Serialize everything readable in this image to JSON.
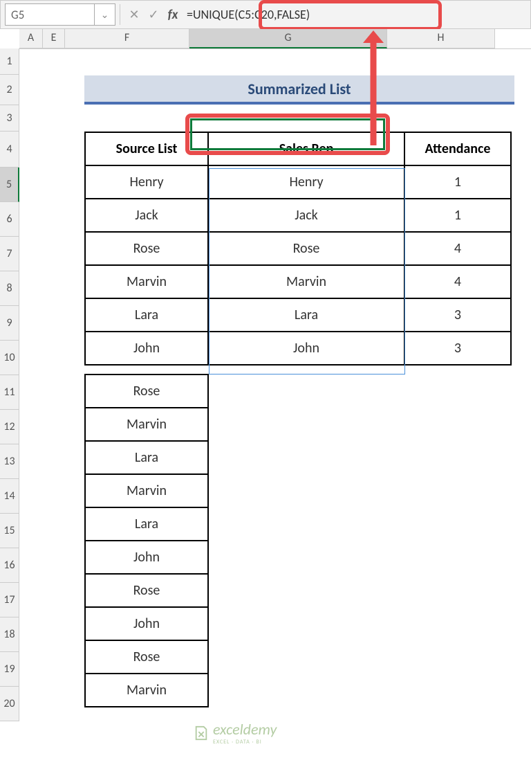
{
  "name_box": "G5",
  "formula": "=UNIQUE(C5:C20,FALSE)",
  "columns": [
    "A",
    "E",
    "F",
    "G",
    "H"
  ],
  "row_numbers": [
    1,
    2,
    3,
    4,
    5,
    6,
    7,
    8,
    9,
    10,
    11,
    12,
    13,
    14,
    15,
    16,
    17,
    18,
    19,
    20
  ],
  "banner_title": "Summarized List",
  "headers": {
    "f": "Source List",
    "g": "Sales Rep",
    "h": "Attendance"
  },
  "source_list": [
    "Henry",
    "Jack",
    "Rose",
    "Marvin",
    "Lara",
    "John",
    "Rose",
    "Marvin",
    "Lara",
    "Marvin",
    "Lara",
    "John",
    "Rose",
    "John",
    "Rose",
    "Marvin"
  ],
  "sales_rep": [
    "Henry",
    "Jack",
    "Rose",
    "Marvin",
    "Lara",
    "John"
  ],
  "attendance": [
    1,
    1,
    4,
    4,
    3,
    3
  ],
  "watermark": {
    "brand": "exceldemy",
    "tagline": "EXCEL · DATA · BI"
  },
  "chart_data": {
    "type": "table",
    "title": "Summarized List",
    "columns": [
      "Source List",
      "Sales Rep",
      "Attendance"
    ],
    "rows": [
      [
        "Henry",
        "Henry",
        1
      ],
      [
        "Jack",
        "Jack",
        1
      ],
      [
        "Rose",
        "Rose",
        4
      ],
      [
        "Marvin",
        "Marvin",
        4
      ],
      [
        "Lara",
        "Lara",
        3
      ],
      [
        "John",
        "John",
        3
      ],
      [
        "Rose",
        "",
        ""
      ],
      [
        "Marvin",
        "",
        ""
      ],
      [
        "Lara",
        "",
        ""
      ],
      [
        "Marvin",
        "",
        ""
      ],
      [
        "Lara",
        "",
        ""
      ],
      [
        "John",
        "",
        ""
      ],
      [
        "Rose",
        "",
        ""
      ],
      [
        "John",
        "",
        ""
      ],
      [
        "Rose",
        "",
        ""
      ],
      [
        "Marvin",
        "",
        ""
      ]
    ]
  }
}
